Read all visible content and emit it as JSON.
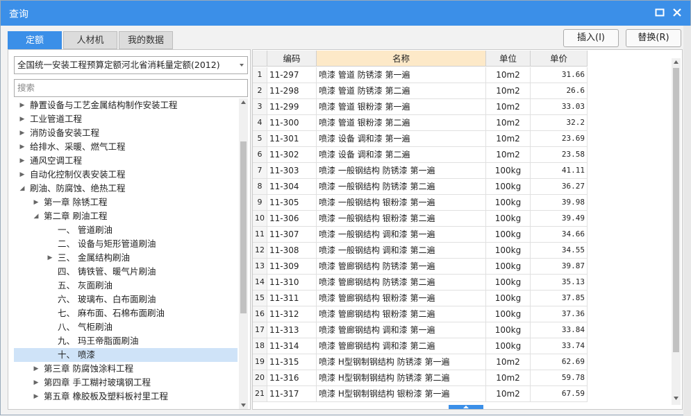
{
  "window": {
    "title": "查询"
  },
  "tabs": [
    {
      "label": "定额",
      "active": true
    },
    {
      "label": "人材机",
      "active": false
    },
    {
      "label": "我的数据",
      "active": false
    }
  ],
  "toolbar": {
    "insert_label": "插入(I)",
    "replace_label": "替换(R)"
  },
  "left": {
    "library_selected": "全国统一安装工程预算定额河北省消耗量定额(2012)",
    "search_placeholder": "搜索"
  },
  "tree": [
    {
      "label": "静置设备与工艺金属结构制作安装工程",
      "level": 0,
      "caret": "right"
    },
    {
      "label": "工业管道工程",
      "level": 0,
      "caret": "right"
    },
    {
      "label": "消防设备安装工程",
      "level": 0,
      "caret": "right"
    },
    {
      "label": "给排水、采暖、燃气工程",
      "level": 0,
      "caret": "right"
    },
    {
      "label": "通风空调工程",
      "level": 0,
      "caret": "right"
    },
    {
      "label": "自动化控制仪表安装工程",
      "level": 0,
      "caret": "right"
    },
    {
      "label": "刷油、防腐蚀、绝热工程",
      "level": 0,
      "caret": "down"
    },
    {
      "label": "第一章 除锈工程",
      "level": 1,
      "caret": "right"
    },
    {
      "label": "第二章 刷油工程",
      "level": 1,
      "caret": "down"
    },
    {
      "label": "一、 管道刷油",
      "level": 2,
      "caret": ""
    },
    {
      "label": "二、 设备与矩形管道刷油",
      "level": 2,
      "caret": ""
    },
    {
      "label": "三、 金属结构刷油",
      "level": 2,
      "caret": "right"
    },
    {
      "label": "四、 铸铁管、暖气片刷油",
      "level": 2,
      "caret": ""
    },
    {
      "label": "五、 灰面刷油",
      "level": 2,
      "caret": ""
    },
    {
      "label": "六、 玻璃布、白布面刷油",
      "level": 2,
      "caret": ""
    },
    {
      "label": "七、 麻布面、石棉布面刷油",
      "level": 2,
      "caret": ""
    },
    {
      "label": "八、 气柜刷油",
      "level": 2,
      "caret": ""
    },
    {
      "label": "九、 玛王帝脂面刷油",
      "level": 2,
      "caret": ""
    },
    {
      "label": "十、 喷漆",
      "level": 2,
      "caret": "",
      "selected": true
    },
    {
      "label": "第三章 防腐蚀涂料工程",
      "level": 1,
      "caret": "right"
    },
    {
      "label": "第四章 手工糊衬玻璃钢工程",
      "level": 1,
      "caret": "right"
    },
    {
      "label": "第五章 橡胶板及塑料板衬里工程",
      "level": 1,
      "caret": "right"
    }
  ],
  "table": {
    "headers": {
      "code": "编码",
      "name": "名称",
      "unit": "单位",
      "price": "单价"
    },
    "rows": [
      {
        "idx": "1",
        "code": "11-297",
        "name": "喷漆 管道 防锈漆 第一遍",
        "unit": "10m2",
        "price": "31.66"
      },
      {
        "idx": "2",
        "code": "11-298",
        "name": "喷漆 管道 防锈漆 第二遍",
        "unit": "10m2",
        "price": "26.6"
      },
      {
        "idx": "3",
        "code": "11-299",
        "name": "喷漆 管道 银粉漆 第一遍",
        "unit": "10m2",
        "price": "33.03"
      },
      {
        "idx": "4",
        "code": "11-300",
        "name": "喷漆 管道 银粉漆 第二遍",
        "unit": "10m2",
        "price": "32.2"
      },
      {
        "idx": "5",
        "code": "11-301",
        "name": "喷漆 设备 调和漆 第一遍",
        "unit": "10m2",
        "price": "23.69"
      },
      {
        "idx": "6",
        "code": "11-302",
        "name": "喷漆 设备 调和漆 第二遍",
        "unit": "10m2",
        "price": "23.58"
      },
      {
        "idx": "7",
        "code": "11-303",
        "name": "喷漆 一般钢结构 防锈漆 第一遍",
        "unit": "100kg",
        "price": "41.11"
      },
      {
        "idx": "8",
        "code": "11-304",
        "name": "喷漆 一般钢结构 防锈漆 第二遍",
        "unit": "100kg",
        "price": "36.27"
      },
      {
        "idx": "9",
        "code": "11-305",
        "name": "喷漆 一般钢结构 银粉漆 第一遍",
        "unit": "100kg",
        "price": "39.98"
      },
      {
        "idx": "10",
        "code": "11-306",
        "name": "喷漆 一般钢结构 银粉漆 第二遍",
        "unit": "100kg",
        "price": "39.49"
      },
      {
        "idx": "11",
        "code": "11-307",
        "name": "喷漆 一般钢结构 调和漆 第一遍",
        "unit": "100kg",
        "price": "34.66"
      },
      {
        "idx": "12",
        "code": "11-308",
        "name": "喷漆 一般钢结构 调和漆 第二遍",
        "unit": "100kg",
        "price": "34.55"
      },
      {
        "idx": "13",
        "code": "11-309",
        "name": "喷漆 管廊钢结构 防锈漆 第一遍",
        "unit": "100kg",
        "price": "39.87"
      },
      {
        "idx": "14",
        "code": "11-310",
        "name": "喷漆 管廊钢结构 防锈漆 第二遍",
        "unit": "100kg",
        "price": "35.13"
      },
      {
        "idx": "15",
        "code": "11-311",
        "name": "喷漆 管廊钢结构 银粉漆 第一遍",
        "unit": "100kg",
        "price": "37.85"
      },
      {
        "idx": "16",
        "code": "11-312",
        "name": "喷漆 管廊钢结构 银粉漆 第二遍",
        "unit": "100kg",
        "price": "37.36"
      },
      {
        "idx": "17",
        "code": "11-313",
        "name": "喷漆 管廊钢结构 调和漆 第一遍",
        "unit": "100kg",
        "price": "33.84"
      },
      {
        "idx": "18",
        "code": "11-314",
        "name": "喷漆 管廊钢结构 调和漆 第二遍",
        "unit": "100kg",
        "price": "33.74"
      },
      {
        "idx": "19",
        "code": "11-315",
        "name": "喷漆 H型钢制钢结构 防锈漆 第一遍",
        "unit": "10m2",
        "price": "62.69"
      },
      {
        "idx": "20",
        "code": "11-316",
        "name": "喷漆 H型钢制钢结构 防锈漆 第二遍",
        "unit": "10m2",
        "price": "59.78"
      },
      {
        "idx": "21",
        "code": "11-317",
        "name": "喷漆 H型钢制钢结构 银粉漆 第一遍",
        "unit": "10m2",
        "price": "67.59"
      }
    ]
  },
  "colors": {
    "accent": "#3b8fe8",
    "header_highlight": "#fde9c8",
    "selected_row": "#cfe3f8"
  }
}
